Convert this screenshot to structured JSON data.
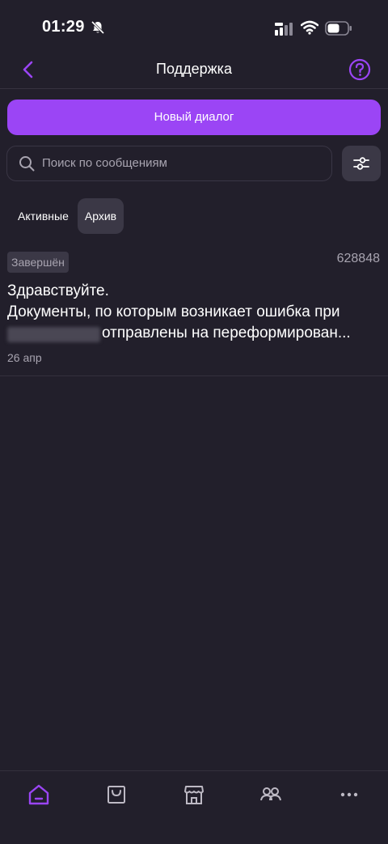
{
  "status_bar": {
    "time": "01:29",
    "icons": [
      "bell-muted-icon",
      "signal-icon",
      "wifi-icon",
      "battery-icon"
    ]
  },
  "navbar": {
    "title": "Поддержка",
    "back_icon": "chevron-left-icon",
    "help_icon": "question-circle-icon"
  },
  "actions": {
    "new_dialog_label": "Новый диалог"
  },
  "search": {
    "placeholder": "Поиск по сообщениям",
    "value": ""
  },
  "tabs": [
    {
      "label": "Активные",
      "selected": false
    },
    {
      "label": "Архив",
      "selected": true
    }
  ],
  "dialogs": [
    {
      "status": "Завершён",
      "id": "628848",
      "message_line1": "Здравствуйте.",
      "message_line2": "Документы, по которым возникает ошибка при",
      "message_line3": "отправлены на переформирован...",
      "date": "26 апр"
    }
  ],
  "bottom_tabs": [
    {
      "icon": "home-icon",
      "active": true
    },
    {
      "icon": "shopping-bag-icon",
      "active": false
    },
    {
      "icon": "store-icon",
      "active": false
    },
    {
      "icon": "people-icon",
      "active": false
    },
    {
      "icon": "more-icon",
      "active": false
    }
  ],
  "colors": {
    "background": "#221f2b",
    "accent": "#9b45f5",
    "surface": "#3b3846",
    "muted_text": "#a8a4b0"
  }
}
